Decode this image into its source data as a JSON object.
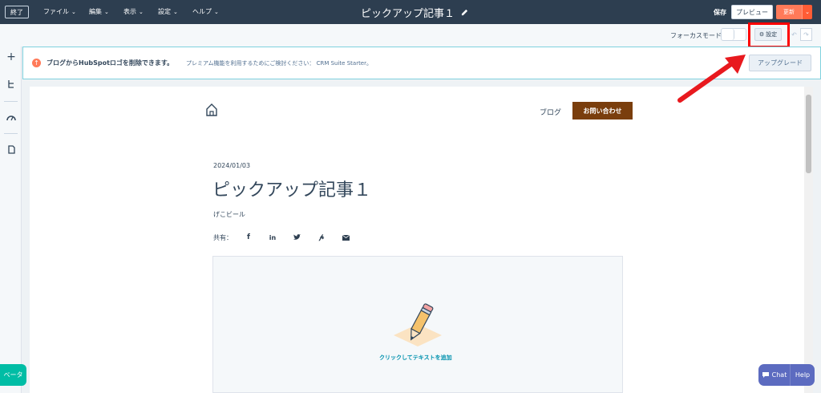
{
  "topbar": {
    "exit_label": "終了",
    "menus": [
      {
        "label": "ファイル"
      },
      {
        "label": "編集"
      },
      {
        "label": "表示"
      },
      {
        "label": "設定"
      },
      {
        "label": "ヘルプ"
      }
    ],
    "doc_title": "ピックアップ記事１",
    "save_label": "保存",
    "preview_label": "プレビュー",
    "update_label": "更新"
  },
  "subbar": {
    "focus_mode_label": "フォーカスモード",
    "settings_label": "設定"
  },
  "banner": {
    "title": "ブログからHubSpotロゴを削除できます。",
    "description": "プレミアム機能を利用するためにご検討ください： CRM Suite Starter。",
    "upgrade_label": "アップグレード"
  },
  "page": {
    "nav_blog": "ブログ",
    "contact_label": "お問い合わせ",
    "post_date": "2024/01/03",
    "post_title": "ピックアップ記事１",
    "author": "げこビール",
    "share_label": "共有：",
    "share_icons": [
      "facebook-icon",
      "linkedin-icon",
      "twitter-icon",
      "pinterest-icon",
      "email-icon"
    ],
    "add_text_label": "クリックしてテキストを追加"
  },
  "widgets": {
    "beta_label": "ベータ",
    "chat_label": "Chat",
    "help_label": "Help"
  },
  "colors": {
    "topbar_bg": "#2d3e50",
    "accent_orange": "#ff7a59",
    "contact_btn": "#7a3e0d",
    "highlight_red": "#ff0000",
    "beta_teal": "#00bda5",
    "chat_purple": "#5c6bc0"
  }
}
